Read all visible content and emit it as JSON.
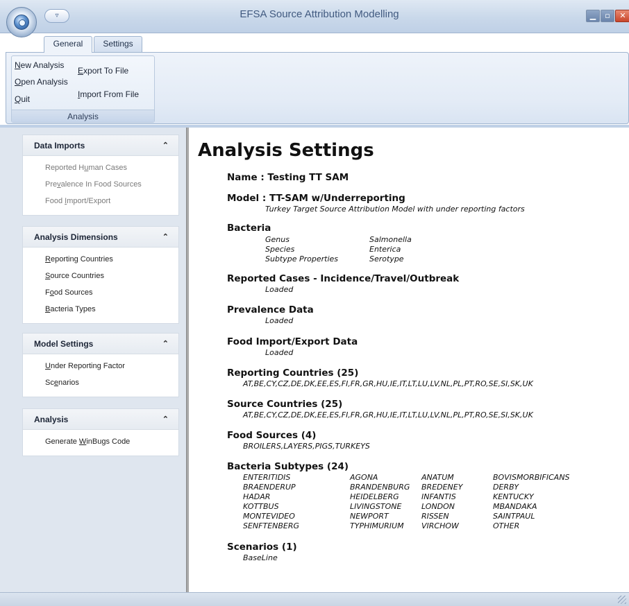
{
  "window": {
    "title": "EFSA Source Attribution Modelling",
    "qat_arrow": "▿",
    "controls": {
      "minimize": "▁",
      "maximize": "▫",
      "close": "✕"
    }
  },
  "ribbon": {
    "tabs": [
      "General",
      "Settings"
    ],
    "group_label": "Analysis",
    "buttons": {
      "new_analysis": {
        "first": "N",
        "rest": "ew Analysis"
      },
      "open_analysis": {
        "first": "O",
        "rest": "pen Analysis"
      },
      "quit": {
        "first": "Q",
        "rest": "uit"
      },
      "export": {
        "first": "E",
        "rest": "xport To File"
      },
      "import": {
        "first": "I",
        "rest": "mport From File"
      }
    }
  },
  "sidebar": {
    "chevron": "⌃",
    "panels": [
      {
        "title": "Data Imports",
        "items": [
          {
            "pre": "Reported H",
            "ul": "u",
            "post": "man Cases"
          },
          {
            "pre": "Pre",
            "ul": "v",
            "post": "alence In Food Sources"
          },
          {
            "pre": "Food ",
            "ul": "I",
            "post": "mport/Export"
          }
        ]
      },
      {
        "title": "Analysis Dimensions",
        "items": [
          {
            "pre": "",
            "ul": "R",
            "post": "eporting Countries"
          },
          {
            "pre": "",
            "ul": "S",
            "post": "ource Countries"
          },
          {
            "pre": "F",
            "ul": "o",
            "post": "od Sources"
          },
          {
            "pre": "",
            "ul": "B",
            "post": "acteria Types"
          }
        ]
      },
      {
        "title": "Model Settings",
        "items": [
          {
            "pre": "",
            "ul": "U",
            "post": "nder Reporting Factor"
          },
          {
            "pre": "Sc",
            "ul": "e",
            "post": "narios"
          }
        ]
      },
      {
        "title": "Analysis",
        "items": [
          {
            "pre": "Generate ",
            "ul": "W",
            "post": "inBugs Code"
          }
        ]
      }
    ]
  },
  "main": {
    "title": "Analysis Settings",
    "name_line": "Name : Testing TT SAM",
    "model_line": "Model : TT-SAM w/Underreporting",
    "model_desc": "Turkey Target Source Attribution Model with under reporting factors",
    "bacteria": {
      "heading": "Bacteria",
      "rows": [
        {
          "key": "Genus",
          "value": "Salmonella"
        },
        {
          "key": "Species",
          "value": "Enterica"
        },
        {
          "key": "Subtype Properties",
          "value": "Serotype"
        }
      ]
    },
    "reported_cases": {
      "heading": "Reported Cases - Incidence/Travel/Outbreak",
      "status": "Loaded"
    },
    "prevalence": {
      "heading": "Prevalence Data",
      "status": "Loaded"
    },
    "food_import": {
      "heading": "Food Import/Export Data",
      "status": "Loaded"
    },
    "reporting_countries": {
      "heading": "Reporting Countries (25)",
      "list": "AT,BE,CY,CZ,DE,DK,EE,ES,FI,FR,GR,HU,IE,IT,LT,LU,LV,NL,PL,PT,RO,SE,SI,SK,UK"
    },
    "source_countries": {
      "heading": "Source Countries (25)",
      "list": "AT,BE,CY,CZ,DE,DK,EE,ES,FI,FR,GR,HU,IE,IT,LT,LU,LV,NL,PL,PT,RO,SE,SI,SK,UK"
    },
    "food_sources": {
      "heading": "Food Sources (4)",
      "list": "BROILERS,LAYERS,PIGS,TURKEYS"
    },
    "bacteria_subtypes": {
      "heading": "Bacteria Subtypes (24)",
      "rows": [
        [
          "ENTERITIDIS",
          "AGONA",
          "ANATUM",
          "BOVISMORBIFICANS"
        ],
        [
          "BRAENDERUP",
          "BRANDENBURG",
          "BREDENEY",
          "DERBY"
        ],
        [
          "HADAR",
          "HEIDELBERG",
          "INFANTIS",
          "KENTUCKY"
        ],
        [
          "KOTTBUS",
          "LIVINGSTONE",
          "LONDON",
          "MBANDAKA"
        ],
        [
          "MONTEVIDEO",
          "NEWPORT",
          "RISSEN",
          "SAINTPAUL"
        ],
        [
          "SENFTENBERG",
          "TYPHIMURIUM",
          "VIRCHOW",
          "OTHER"
        ]
      ]
    },
    "scenarios": {
      "heading": "Scenarios (1)",
      "list": "BaseLine"
    }
  }
}
